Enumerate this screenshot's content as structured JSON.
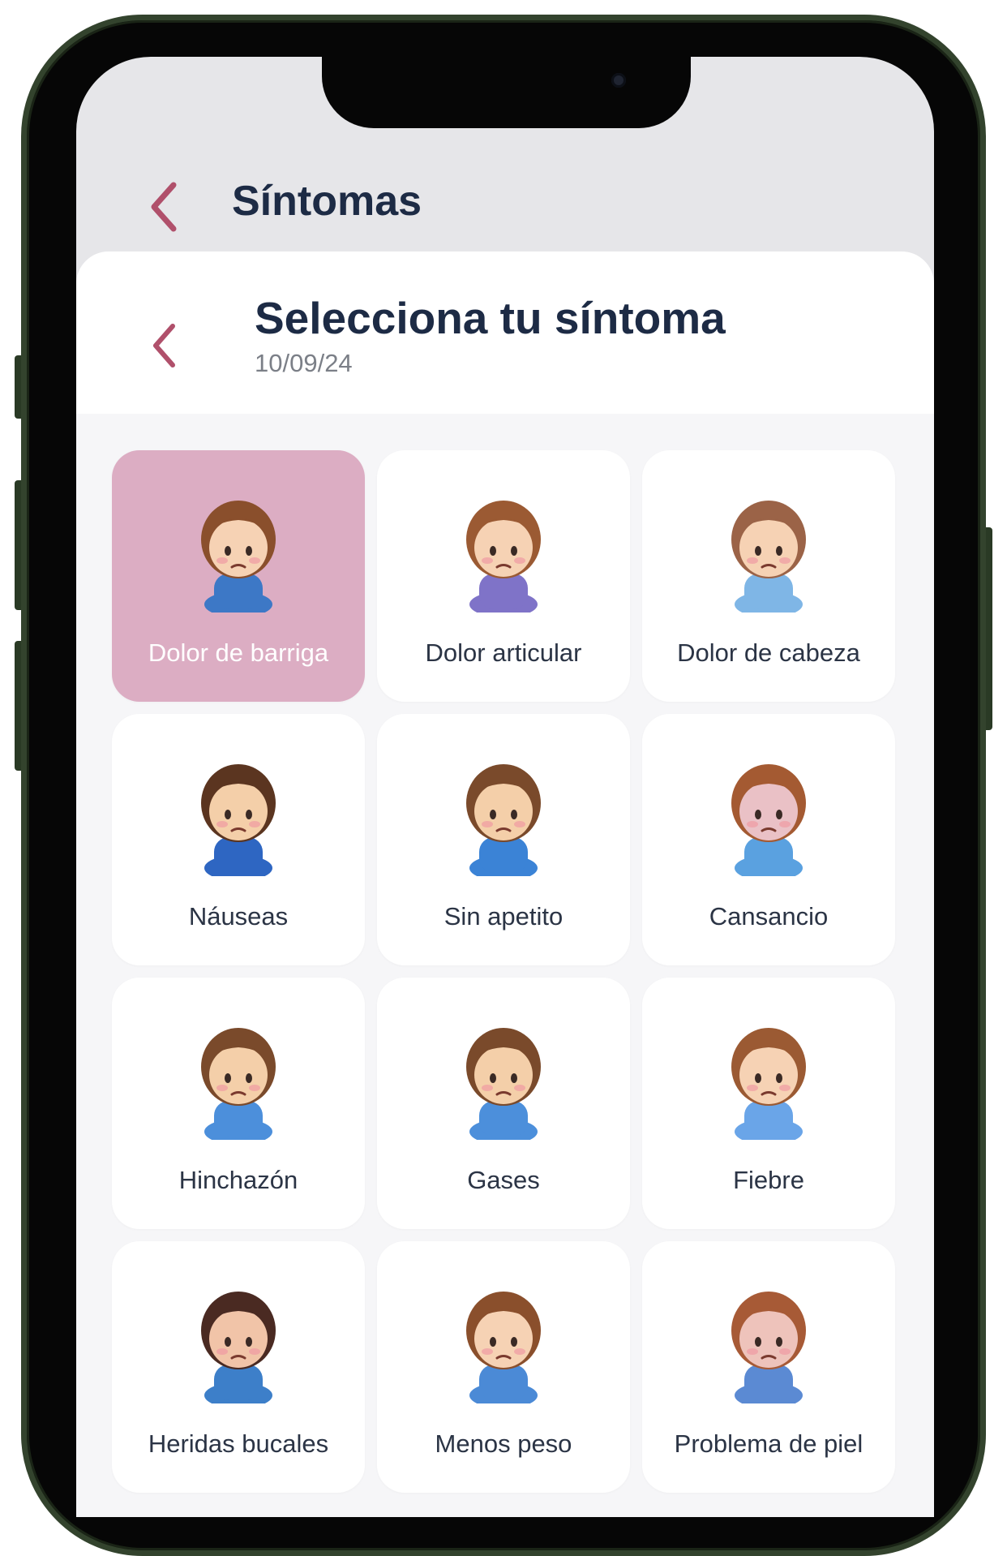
{
  "app": {
    "title": "Síntomas",
    "back_icon": "chevron-left-icon"
  },
  "sheet": {
    "title": "Selecciona tu síntoma",
    "date": "10/09/24",
    "back_icon": "chevron-left-icon"
  },
  "colors": {
    "accent": "#b0506b",
    "selected_card": "#dcadc3",
    "title_text": "#1d2b45"
  },
  "symptoms": [
    {
      "label": "Dolor de barriga",
      "selected": true,
      "icon": "girl-stomach-ache-icon"
    },
    {
      "label": "Dolor articular",
      "selected": false,
      "icon": "girl-joint-pain-icon"
    },
    {
      "label": "Dolor de cabeza",
      "selected": false,
      "icon": "girl-headache-icon"
    },
    {
      "label": "Náuseas",
      "selected": false,
      "icon": "boy-nausea-icon"
    },
    {
      "label": "Sin apetito",
      "selected": false,
      "icon": "boy-no-appetite-icon"
    },
    {
      "label": "Cansancio",
      "selected": false,
      "icon": "boy-tired-icon"
    },
    {
      "label": "Hinchazón",
      "selected": false,
      "icon": "boy-bloating-icon"
    },
    {
      "label": "Gases",
      "selected": false,
      "icon": "boy-gas-icon"
    },
    {
      "label": "Fiebre",
      "selected": false,
      "icon": "girl-fever-icon"
    },
    {
      "label": "Heridas bucales",
      "selected": false,
      "icon": "girl-mouth-sores-icon"
    },
    {
      "label": "Menos peso",
      "selected": false,
      "icon": "girl-weight-loss-icon"
    },
    {
      "label": "Problema de piel",
      "selected": false,
      "icon": "girl-skin-problem-icon"
    }
  ]
}
